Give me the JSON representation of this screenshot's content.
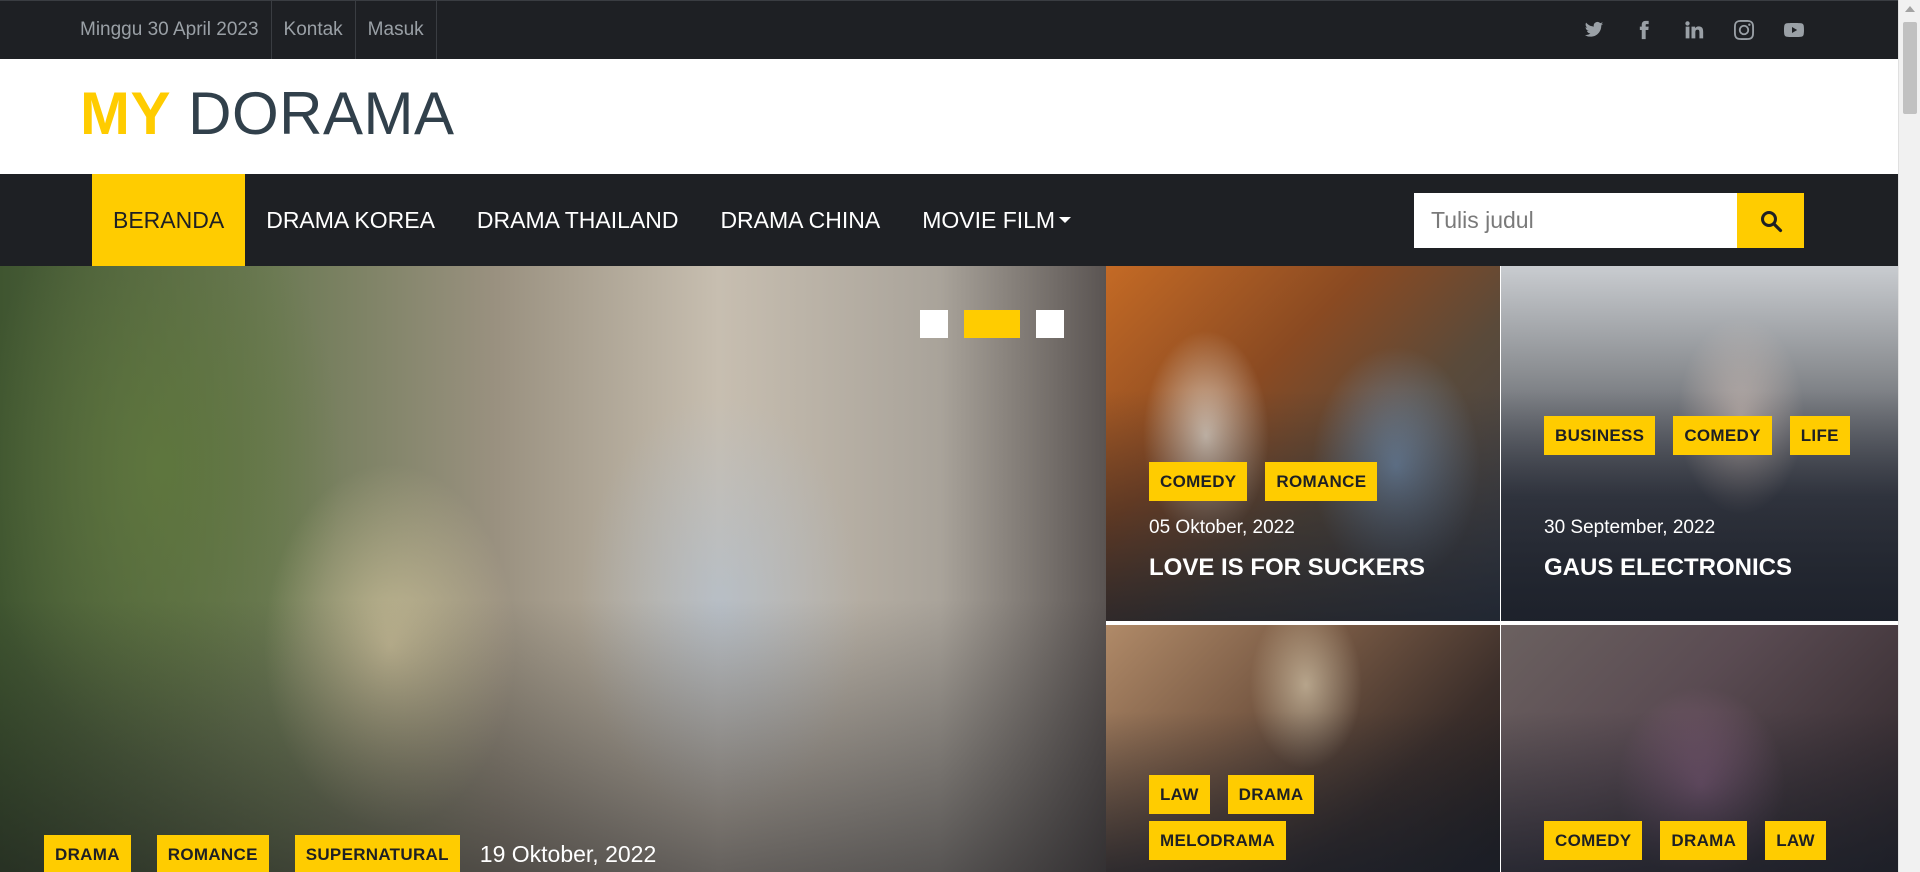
{
  "topbar": {
    "date": "Minggu 30 April 2023",
    "links": [
      "Kontak",
      "Masuk"
    ],
    "social_icons": [
      "twitter-icon",
      "facebook-icon",
      "linkedin-icon",
      "instagram-icon",
      "youtube-icon"
    ]
  },
  "logo": {
    "part1": "MY",
    "part2": "DORAMA"
  },
  "nav": {
    "items": [
      "BERANDA",
      "DRAMA KOREA",
      "DRAMA THAILAND",
      "DRAMA CHINA",
      "MOVIE FILM"
    ],
    "active_index": 0,
    "search_placeholder": "Tulis judul",
    "search_icon": "search-icon"
  },
  "hero": {
    "tags": [
      "DRAMA",
      "ROMANCE",
      "SUPERNATURAL"
    ],
    "date": "19 Oktober, 2022",
    "slide_count": 3,
    "active_slide_index": 1
  },
  "cards": [
    {
      "tags": [
        "COMEDY",
        "ROMANCE"
      ],
      "date": "05 Oktober, 2022",
      "title": "LOVE IS FOR SUCKERS"
    },
    {
      "tags": [
        "BUSINESS",
        "COMEDY",
        "LIFE"
      ],
      "date": "30 September, 2022",
      "title": "GAUS ELECTRONICS"
    },
    {
      "tags": [
        "LAW",
        "DRAMA",
        "MELODRAMA"
      ]
    },
    {
      "tags": [
        "COMEDY",
        "DRAMA",
        "LAW"
      ]
    }
  ],
  "colors": {
    "accent": "#ffcc00",
    "dark": "#1e2024",
    "logo_text": "#31404b"
  }
}
